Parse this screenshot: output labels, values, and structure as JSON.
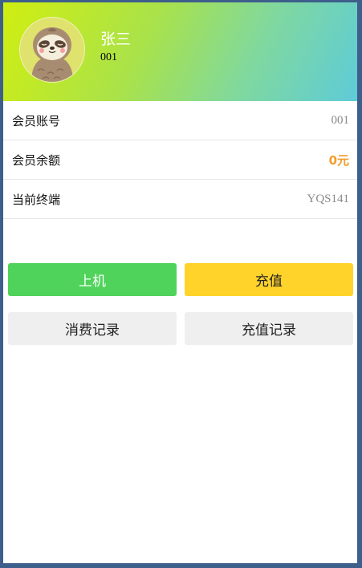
{
  "profile": {
    "name": "张三",
    "id": "001",
    "avatar_icon": "sloth-avatar-icon"
  },
  "info": [
    {
      "label": "会员账号",
      "value": "001"
    },
    {
      "label": "会员余额",
      "value": "0元"
    },
    {
      "label": "当前终端",
      "value": "YQS141"
    }
  ],
  "buttons": {
    "login": "上机",
    "recharge": "充值",
    "consumption_records": "消费记录",
    "recharge_records": "充值记录"
  },
  "colors": {
    "header_gradient_start": "#d0ee10",
    "header_gradient_end": "#5ecbd8",
    "balance": "#f29d2b",
    "login_button": "#4fd35a",
    "recharge_button": "#ffd32a",
    "record_button": "#efefef"
  }
}
